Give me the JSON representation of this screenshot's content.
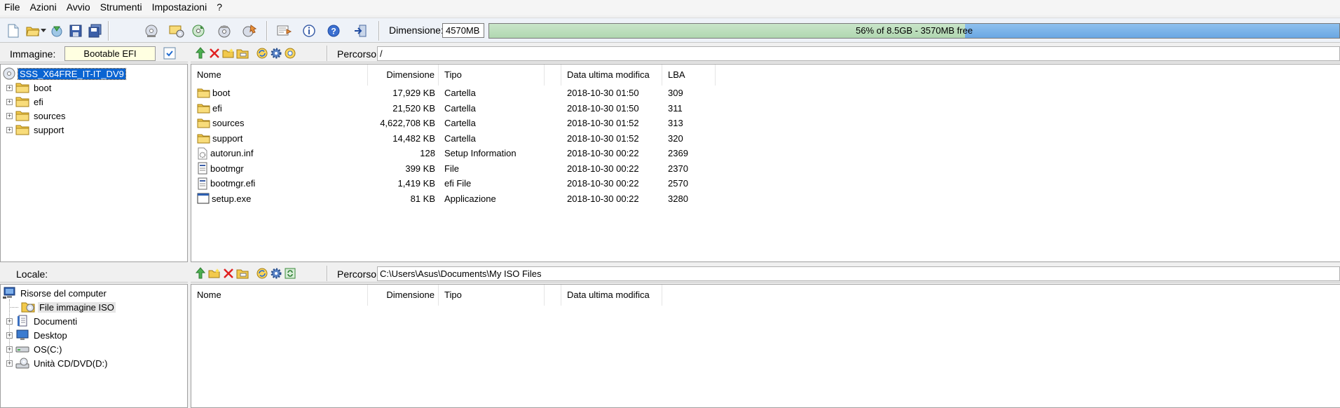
{
  "menu": [
    "File",
    "Azioni",
    "Avvio",
    "Strumenti",
    "Impostazioni",
    "?"
  ],
  "toolbar": {
    "dimension_label": "Dimensione:",
    "dimension_value": "4570MB",
    "capacity_text": "56% of 8.5GB - 3570MB free",
    "capacity_used_fraction": 0.56,
    "buttons": [
      "new-icon",
      "open-icon",
      "open-dropdown-icon",
      "extract-icon",
      "save-icon",
      "save-as-icon",
      "make-cd-icon",
      "mount-icon",
      "compress-icon",
      "burn-icon",
      "virtual-drive-icon",
      "options-icon",
      "properties-icon",
      "help-icon",
      "exit-icon"
    ]
  },
  "image_pane": {
    "label": "Immagine:",
    "boot_type": "Bootable EFI",
    "path_label": "Percorso:",
    "path": "/",
    "tree": {
      "root": "SSS_X64FRE_IT-IT_DV9",
      "children": [
        "boot",
        "efi",
        "sources",
        "support"
      ]
    },
    "columns": [
      "Nome",
      "Dimensione",
      "Tipo",
      "Data ultima modifica",
      "LBA"
    ],
    "rows": [
      {
        "name": "boot",
        "size": "17,929 KB",
        "type": "Cartella",
        "date": "2018-10-30 01:50",
        "lba": "309",
        "icon": "folder-icon"
      },
      {
        "name": "efi",
        "size": "21,520 KB",
        "type": "Cartella",
        "date": "2018-10-30 01:50",
        "lba": "311",
        "icon": "folder-icon"
      },
      {
        "name": "sources",
        "size": "4,622,708 KB",
        "type": "Cartella",
        "date": "2018-10-30 01:52",
        "lba": "313",
        "icon": "folder-icon"
      },
      {
        "name": "support",
        "size": "14,482 KB",
        "type": "Cartella",
        "date": "2018-10-30 01:52",
        "lba": "320",
        "icon": "folder-icon"
      },
      {
        "name": "autorun.inf",
        "size": "128",
        "type": "Setup Information",
        "date": "2018-10-30 00:22",
        "lba": "2369",
        "icon": "inf-file-icon"
      },
      {
        "name": "bootmgr",
        "size": "399 KB",
        "type": "File",
        "date": "2018-10-30 00:22",
        "lba": "2370",
        "icon": "binary-file-icon"
      },
      {
        "name": "bootmgr.efi",
        "size": "1,419 KB",
        "type": "efi File",
        "date": "2018-10-30 00:22",
        "lba": "2570",
        "icon": "binary-file-icon"
      },
      {
        "name": "setup.exe",
        "size": "81 KB",
        "type": "Applicazione",
        "date": "2018-10-30 00:22",
        "lba": "3280",
        "icon": "application-icon"
      }
    ]
  },
  "local_pane": {
    "label": "Locale:",
    "path_label": "Percorso:",
    "path": "C:\\Users\\Asus\\Documents\\My ISO Files",
    "tree": {
      "root": "Risorse del computer",
      "children": [
        {
          "label": "File immagine ISO",
          "icon": "iso-folder-icon",
          "expandable": false
        },
        {
          "label": "Documenti",
          "icon": "documents-icon",
          "expandable": true
        },
        {
          "label": "Desktop",
          "icon": "desktop-icon",
          "expandable": true
        },
        {
          "label": "OS(C:)",
          "icon": "hard-drive-icon",
          "expandable": true
        },
        {
          "label": "Unità CD/DVD(D:)",
          "icon": "cd-drive-icon",
          "expandable": true
        }
      ]
    },
    "columns": [
      "Nome",
      "Dimensione",
      "Tipo",
      "Data ultima modifica"
    ]
  },
  "colors": {
    "selection": "#0a64d2",
    "capacity_used": "#b8dbb8",
    "capacity_free": "#7ab3e8",
    "folder": "#f2c94c"
  }
}
